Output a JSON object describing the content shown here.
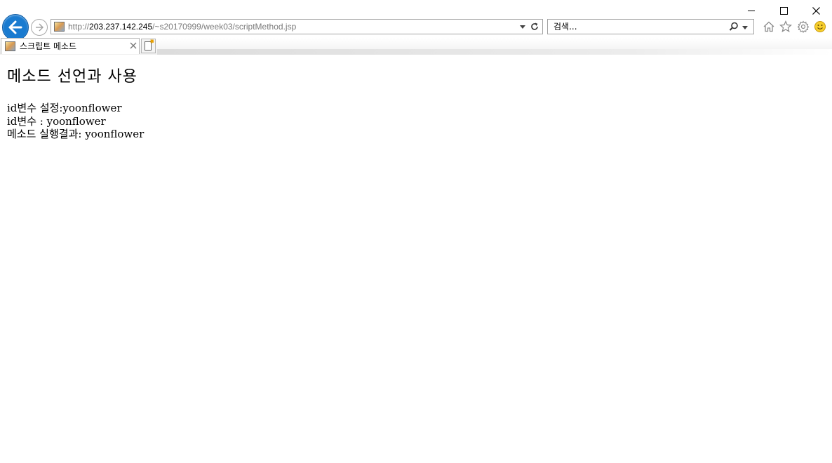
{
  "browser": {
    "address_bar": {
      "url_prefix": "http://",
      "url_host": "203.237.142.245",
      "url_path": "/~s20170999/week03/scriptMethod.jsp"
    },
    "search": {
      "placeholder": "검색..."
    },
    "tabs": [
      {
        "title": "스크립트 메소드"
      }
    ],
    "toolbar_icons": [
      "home-icon",
      "star-icon",
      "gear-icon",
      "smiley-icon"
    ],
    "colors": {
      "back_button": "#1a7bd0"
    }
  },
  "page": {
    "heading": "메소드 선언과 사용",
    "lines": [
      "id변수 설정:yoonflower",
      "id변수 : yoonflower",
      "메소드 실행결과: yoonflower"
    ]
  }
}
